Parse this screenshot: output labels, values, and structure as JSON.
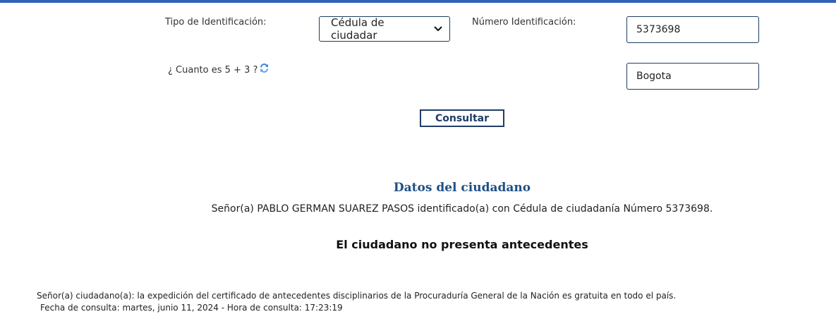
{
  "form": {
    "tipo_label": "Tipo de Identificación:",
    "tipo_selected": "Cédula de ciudadar",
    "numero_label": "Número Identificación:",
    "numero_value": "5373698",
    "captcha_question": "¿ Cuanto es 5 + 3 ?",
    "captcha_answer": "Bogota",
    "submit_label": "Consultar"
  },
  "result": {
    "section_title": "Datos del ciudadano",
    "citizen_line": "Señor(a)  PABLO GERMAN SUAREZ PASOS identificado(a) con Cédula de ciudadanía Número 5373698.",
    "status": "El ciudadano no presenta antecedentes"
  },
  "footer": {
    "notice": "Señor(a) ciudadano(a): la expedición del certificado de antecedentes disciplinarios de la Procuraduría General de la Nación es gratuita en todo el país.",
    "timestamp": "Fecha de consulta: martes, junio 11, 2024 - Hora de consulta: 17:23:19"
  },
  "icons": {
    "refresh": "refresh-icon",
    "dropdown": "chevron-down-icon"
  },
  "colors": {
    "top_bar": "#2f62b8",
    "field_border": "#1f3d66",
    "title": "#1e4f85"
  }
}
